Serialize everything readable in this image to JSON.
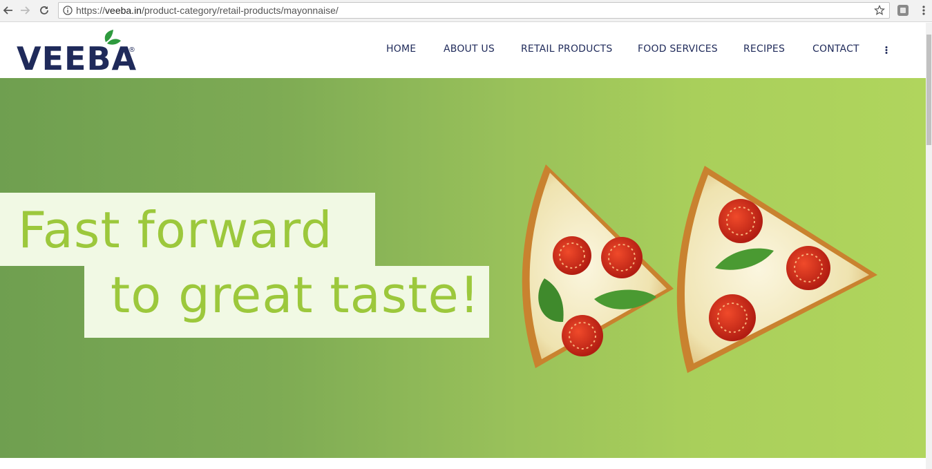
{
  "browser": {
    "url_scheme": "https://",
    "url_host": "veeba.in",
    "url_path": "/product-category/retail-products/mayonnaise/",
    "icons": [
      "back-icon",
      "forward-icon",
      "reload-icon",
      "info-icon",
      "star-icon",
      "extension-icon",
      "menu-icon"
    ]
  },
  "site": {
    "logo_text": "VEEBA",
    "logo_mark": "®",
    "nav": [
      {
        "label": "HOME"
      },
      {
        "label": "ABOUT US"
      },
      {
        "label": "RETAIL PRODUCTS"
      },
      {
        "label": "FOOD SERVICES"
      },
      {
        "label": "RECIPES"
      },
      {
        "label": "CONTACT"
      }
    ],
    "more_icon": "vertical-dots-icon"
  },
  "hero": {
    "line1": "Fast forward",
    "line2": "to great taste!",
    "accent_color": "#9cc83c",
    "band_color": "#f1f9e4",
    "bg_colors": [
      "#6f9f50",
      "#b0d55d"
    ],
    "image": "two pizza slices forming fast-forward arrows"
  },
  "colors": {
    "brand_navy": "#1f2a5a",
    "leaf_green": "#2e9a3e"
  }
}
